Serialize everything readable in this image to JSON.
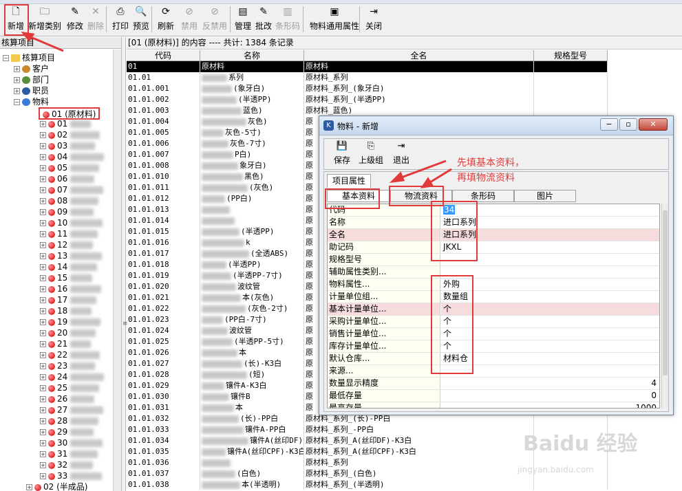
{
  "toolbar": {
    "items": [
      {
        "label": "新增",
        "icon": "new-doc-icon",
        "glyph": "🗋",
        "enabled": true
      },
      {
        "label": "新增类别",
        "icon": "folder-icon",
        "glyph": "🗀",
        "enabled": true
      },
      {
        "label": "修改",
        "icon": "edit-icon",
        "glyph": "✎",
        "enabled": true
      },
      {
        "label": "删除",
        "icon": "delete-icon",
        "glyph": "✕",
        "enabled": false
      },
      {
        "label": "打印",
        "icon": "print-icon",
        "glyph": "⎙",
        "enabled": true
      },
      {
        "label": "预览",
        "icon": "preview-icon",
        "glyph": "🔍",
        "enabled": true
      },
      {
        "label": "刷新",
        "icon": "refresh-icon",
        "glyph": "⟳",
        "enabled": true
      },
      {
        "label": "禁用",
        "icon": "disable-icon",
        "glyph": "⊘",
        "enabled": false
      },
      {
        "label": "反禁用",
        "icon": "enable-icon",
        "glyph": "⊘",
        "enabled": false
      },
      {
        "label": "管理",
        "icon": "manage-icon",
        "glyph": "▤",
        "enabled": true
      },
      {
        "label": "批改",
        "icon": "batch-edit-icon",
        "glyph": "✎",
        "enabled": true
      },
      {
        "label": "条形码",
        "icon": "barcode-icon",
        "glyph": "▥",
        "enabled": false
      },
      {
        "label": "物料通用属性",
        "icon": "properties-icon",
        "glyph": "▣",
        "enabled": true
      },
      {
        "label": "关闭",
        "icon": "exit-icon",
        "glyph": "⇥",
        "enabled": true
      }
    ]
  },
  "tree": {
    "header": "核算项目",
    "root": "核算项目",
    "nodes": [
      {
        "label": "客户",
        "icon": "customer-icon"
      },
      {
        "label": "部门",
        "icon": "department-icon"
      },
      {
        "label": "职员",
        "icon": "employee-icon"
      },
      {
        "label": "物料",
        "icon": "material-icon"
      }
    ],
    "selected": "01 (原材料)",
    "children": [
      "01",
      "02",
      "03",
      "04",
      "05",
      "06",
      "07",
      "08",
      "09",
      "10",
      "11",
      "12",
      "13",
      "14",
      "15",
      "16",
      "17",
      "18",
      "19",
      "20",
      "21",
      "22",
      "23",
      "24",
      "25",
      "26",
      "27",
      "28",
      "29",
      "30",
      "31",
      "32",
      "33"
    ],
    "last": "02 (半成品)"
  },
  "grid": {
    "title": "[01 (原材料)] 的内容 ---- 共计: 1384 条记录",
    "columns": [
      "代码",
      "名称",
      "全名",
      "规格型号"
    ],
    "rows": [
      {
        "code": "01",
        "name": "原材料",
        "full": "原材料"
      },
      {
        "code": "01.01",
        "name": "系列",
        "full": "原材料_系列"
      },
      {
        "code": "01.01.001",
        "name": "(象牙白)",
        "full": "原材料_系列_(象牙白)"
      },
      {
        "code": "01.01.002",
        "name": "(半透PP)",
        "full": "原材料_系列_(半透PP)"
      },
      {
        "code": "01.01.003",
        "name": "蓝色)",
        "full": "原材料_蓝色)"
      },
      {
        "code": "01.01.004",
        "name": "灰色)",
        "full": "原"
      },
      {
        "code": "01.01.005",
        "name": "灰色-5寸)",
        "full": "原"
      },
      {
        "code": "01.01.006",
        "name": "灰色-7寸)",
        "full": "原"
      },
      {
        "code": "01.01.007",
        "name": "P白)",
        "full": "原"
      },
      {
        "code": "01.01.008",
        "name": "象牙白)",
        "full": "原"
      },
      {
        "code": "01.01.010",
        "name": "黑色)",
        "full": "原"
      },
      {
        "code": "01.01.011",
        "name": "(灰色)",
        "full": "原"
      },
      {
        "code": "01.01.012",
        "name": "(PP白)",
        "full": "原"
      },
      {
        "code": "01.01.013",
        "name": "",
        "full": "原"
      },
      {
        "code": "01.01.014",
        "name": "",
        "full": "原"
      },
      {
        "code": "01.01.015",
        "name": "(半透PP)",
        "full": "原"
      },
      {
        "code": "01.01.016",
        "name": "k",
        "full": "原"
      },
      {
        "code": "01.01.017",
        "name": "(全透ABS)",
        "full": "原"
      },
      {
        "code": "01.01.018",
        "name": "(半透PP)",
        "full": "原"
      },
      {
        "code": "01.01.019",
        "name": "(半透PP-7寸)",
        "full": "原"
      },
      {
        "code": "01.01.020",
        "name": "波纹管",
        "full": "原"
      },
      {
        "code": "01.01.021",
        "name": "本(灰色)",
        "full": "原"
      },
      {
        "code": "01.01.022",
        "name": "(灰色-2寸)",
        "full": "原"
      },
      {
        "code": "01.01.023",
        "name": "(PP白-7寸)",
        "full": "原"
      },
      {
        "code": "01.01.024",
        "name": "波纹管",
        "full": "原"
      },
      {
        "code": "01.01.025",
        "name": "(半透PP-5寸)",
        "full": "原"
      },
      {
        "code": "01.01.026",
        "name": "本",
        "full": "原"
      },
      {
        "code": "01.01.027",
        "name": "(长)-K3白",
        "full": "原"
      },
      {
        "code": "01.01.028",
        "name": "(短)",
        "full": "原"
      },
      {
        "code": "01.01.029",
        "name": "镶件A-K3白",
        "full": "原"
      },
      {
        "code": "01.01.030",
        "name": "镶件B",
        "full": "原"
      },
      {
        "code": "01.01.031",
        "name": "本",
        "full": "原"
      },
      {
        "code": "01.01.032",
        "name": "(长)-PP白",
        "full": "原材料_系列_(长)-PP白"
      },
      {
        "code": "01.01.033",
        "name": "镶件A-PP白",
        "full": "原材料_系列_-PP白"
      },
      {
        "code": "01.01.034",
        "name": "镶件A(丝印DF)-K3白",
        "full": "原材料_系列_A(丝印DF)-K3白"
      },
      {
        "code": "01.01.035",
        "name": "镶件A(丝印CPF)-K3白",
        "full": "原材料_系列_A(丝印CPF)-K3白"
      },
      {
        "code": "01.01.036",
        "name": "",
        "full": "原材料_系列"
      },
      {
        "code": "01.01.037",
        "name": "(白色)",
        "full": "原材料_系列_(白色)"
      },
      {
        "code": "01.01.038",
        "name": "本(半透明)",
        "full": "原材料_系列_(半透明)"
      }
    ]
  },
  "dialog": {
    "title": "物料 - 新增",
    "toolbar": [
      {
        "label": "保存",
        "icon": "save-icon",
        "glyph": "💾"
      },
      {
        "label": "上级组",
        "icon": "parent-group-icon",
        "glyph": "⎘"
      },
      {
        "label": "退出",
        "icon": "exit-icon",
        "glyph": "⇥"
      }
    ],
    "outer_tab": "项目属性",
    "tabs": [
      "基本资料",
      "物流资料",
      "条形码",
      "图片"
    ],
    "props": [
      {
        "key": "代码",
        "value": "34",
        "pink": false,
        "sel": true
      },
      {
        "key": "名称",
        "value": "进口系列",
        "pink": false
      },
      {
        "key": "全名",
        "value": "进口系列",
        "pink": true
      },
      {
        "key": "助记码",
        "value": "JKXL",
        "pink": false
      },
      {
        "key": "规格型号",
        "value": "",
        "pink": false
      },
      {
        "key": "辅助属性类别...",
        "value": "",
        "pink": false
      },
      {
        "key": "物料属性...",
        "value": "外购",
        "pink": false
      },
      {
        "key": "计量单位组...",
        "value": "数量组",
        "pink": false
      },
      {
        "key": "基本计量单位...",
        "value": "个",
        "pink": true
      },
      {
        "key": "采购计量单位...",
        "value": "个",
        "pink": false
      },
      {
        "key": "销售计量单位...",
        "value": "个",
        "pink": false
      },
      {
        "key": "库存计量单位...",
        "value": "个",
        "pink": false
      },
      {
        "key": "默认仓库...",
        "value": "材料仓",
        "pink": false
      },
      {
        "key": "来源...",
        "value": "",
        "pink": false
      },
      {
        "key": "数量显示精度",
        "value": "4",
        "pink": false,
        "num": true
      },
      {
        "key": "最低存量",
        "value": "0",
        "pink": false,
        "num": true
      },
      {
        "key": "最高存量",
        "value": "1000",
        "pink": false,
        "num": true
      }
    ]
  },
  "annotation": {
    "line1": "先填基本资料，",
    "line2": "再填物流资料",
    "color": "#e23a3a"
  },
  "watermark": {
    "brand": "Baidu 经验",
    "url": "jingyan.baidu.com"
  }
}
